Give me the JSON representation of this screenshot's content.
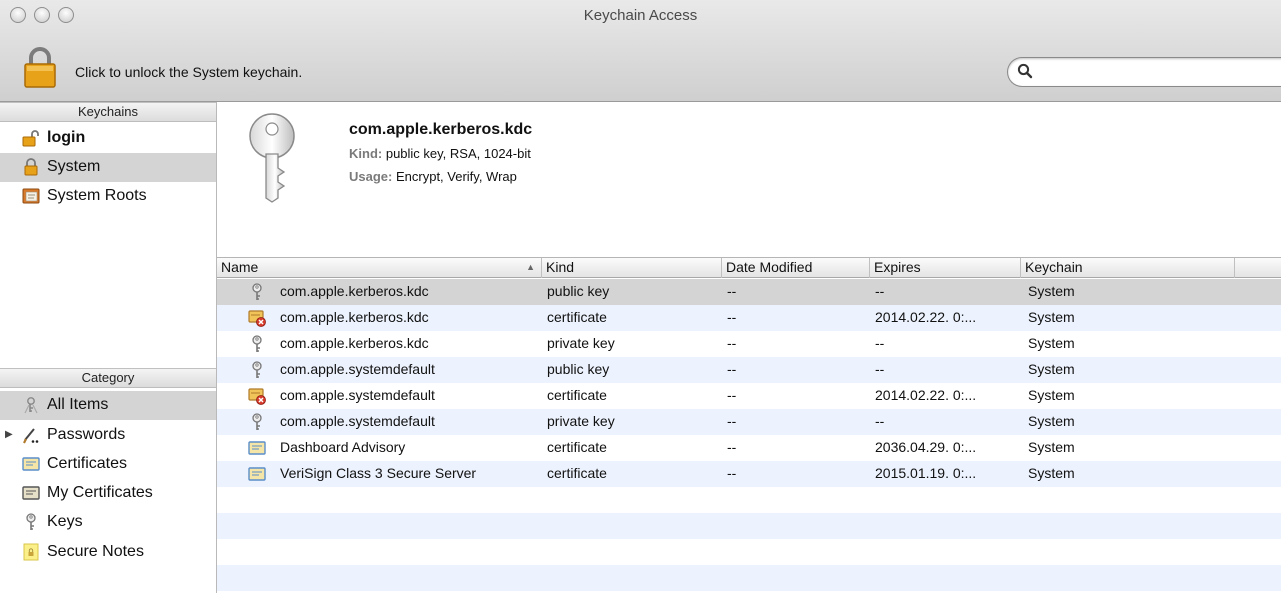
{
  "window": {
    "title": "Keychain Access"
  },
  "toolbar": {
    "lock_text": "Click to unlock the System keychain.",
    "search_placeholder": "",
    "search_value": ""
  },
  "keychains": {
    "header": "Keychains",
    "items": [
      {
        "label": "login",
        "icon": "unlocked-padlock-icon",
        "bold": true
      },
      {
        "label": "System",
        "icon": "locked-padlock-icon",
        "selected": true
      },
      {
        "label": "System Roots",
        "icon": "certificate-cabinet-icon"
      }
    ]
  },
  "category": {
    "header": "Category",
    "items": [
      {
        "label": "All Items",
        "icon": "all-items-icon",
        "selected": true
      },
      {
        "label": "Passwords",
        "icon": "passwords-icon",
        "expandable": true
      },
      {
        "label": "Certificates",
        "icon": "certificate-icon"
      },
      {
        "label": "My Certificates",
        "icon": "my-certificate-icon"
      },
      {
        "label": "Keys",
        "icon": "key-icon"
      },
      {
        "label": "Secure Notes",
        "icon": "secure-note-icon"
      }
    ]
  },
  "detail": {
    "name": "com.apple.kerberos.kdc",
    "kind_label": "Kind:",
    "kind_value": "public key, RSA, 1024-bit",
    "usage_label": "Usage:",
    "usage_value": "Encrypt, Verify, Wrap"
  },
  "table": {
    "columns": [
      "Name",
      "Kind",
      "Date Modified",
      "Expires",
      "Keychain"
    ],
    "sort_column": "Name",
    "rows": [
      {
        "icon": "key-icon",
        "name": "com.apple.kerberos.kdc",
        "kind": "public key",
        "modified": "--",
        "expires": "--",
        "keychain": "System",
        "selected": true
      },
      {
        "icon": "invalid-certificate-icon",
        "name": "com.apple.kerberos.kdc",
        "kind": "certificate",
        "modified": "--",
        "expires": "2014.02.22. 0:...",
        "keychain": "System"
      },
      {
        "icon": "key-icon",
        "name": "com.apple.kerberos.kdc",
        "kind": "private key",
        "modified": "--",
        "expires": "--",
        "keychain": "System"
      },
      {
        "icon": "key-icon",
        "name": "com.apple.systemdefault",
        "kind": "public key",
        "modified": "--",
        "expires": "--",
        "keychain": "System"
      },
      {
        "icon": "invalid-certificate-icon",
        "name": "com.apple.systemdefault",
        "kind": "certificate",
        "modified": "--",
        "expires": "2014.02.22. 0:...",
        "keychain": "System"
      },
      {
        "icon": "key-icon",
        "name": "com.apple.systemdefault",
        "kind": "private key",
        "modified": "--",
        "expires": "--",
        "keychain": "System"
      },
      {
        "icon": "certificate-icon",
        "name": "Dashboard Advisory",
        "kind": "certificate",
        "modified": "--",
        "expires": "2036.04.29. 0:...",
        "keychain": "System"
      },
      {
        "icon": "certificate-icon",
        "name": "VeriSign Class 3 Secure Server",
        "kind": "certificate",
        "modified": "--",
        "expires": "2015.01.19. 0:...",
        "keychain": "System"
      }
    ]
  },
  "colors": {
    "selection": "#d4d4d4",
    "alternate_row": "#edf3fe",
    "toolbar": "#d6d6d6"
  }
}
